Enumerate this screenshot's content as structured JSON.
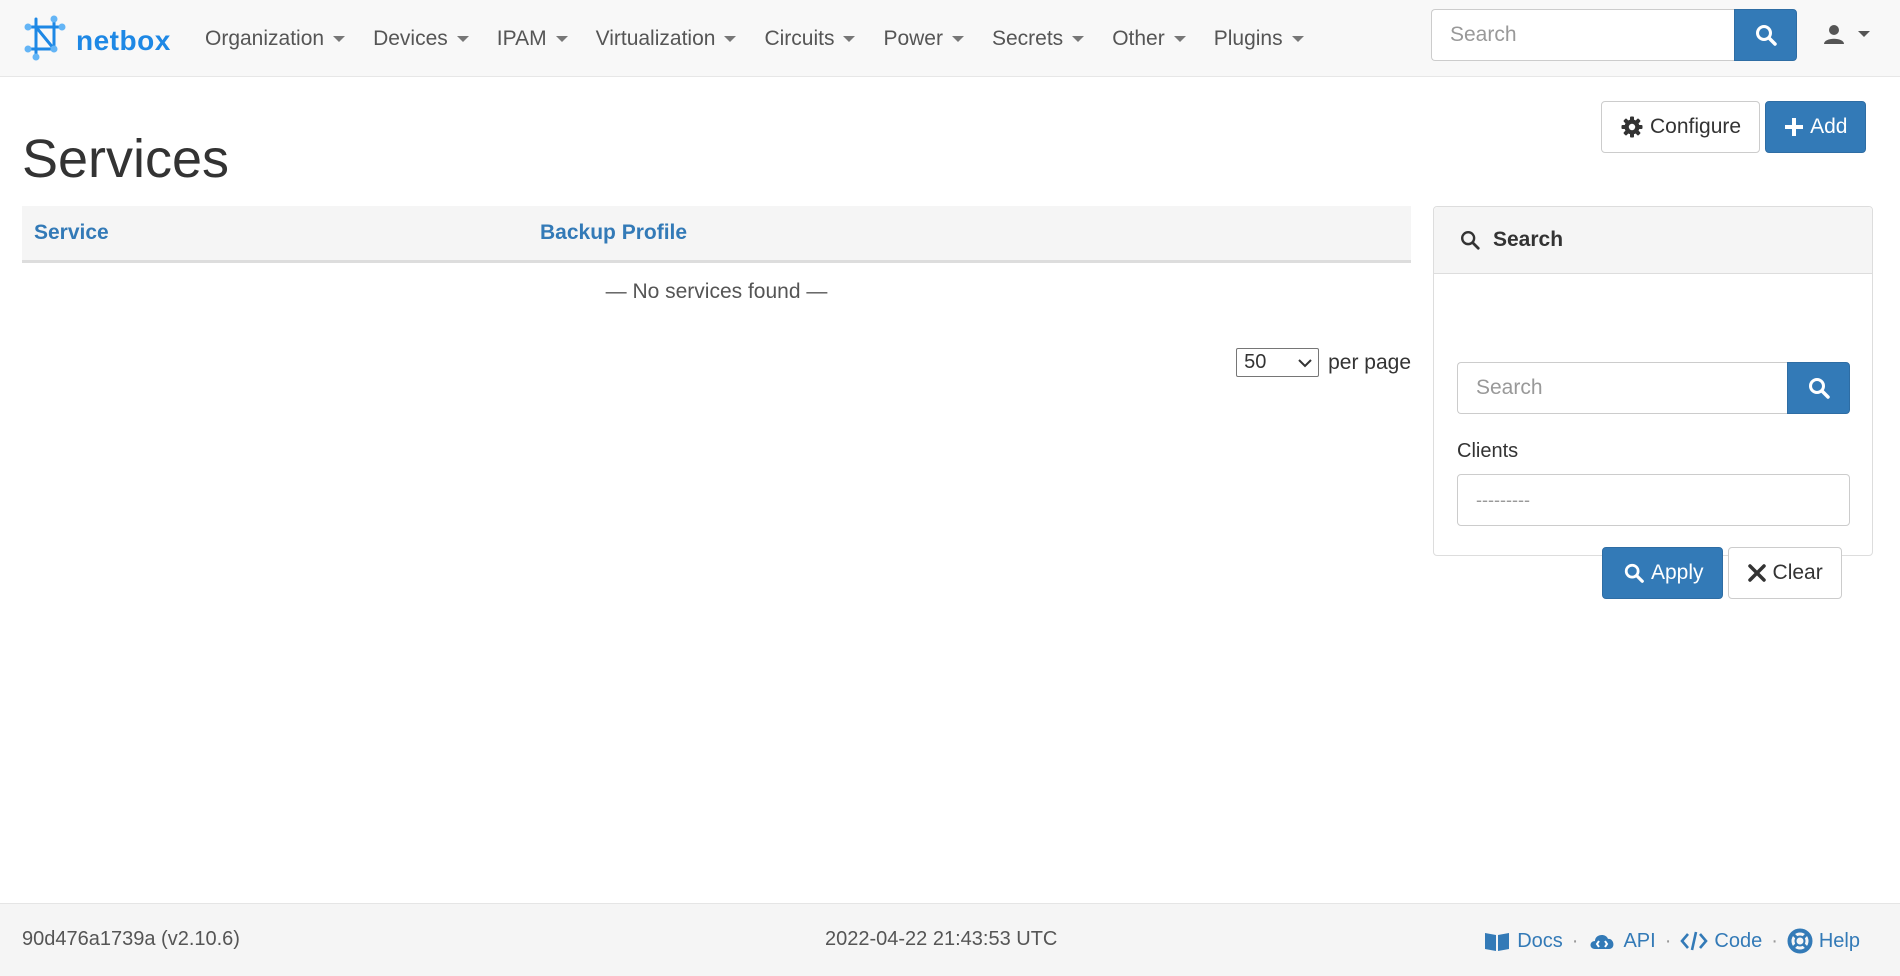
{
  "brand": {
    "name": "netbox"
  },
  "nav": {
    "items": [
      {
        "label": "Organization"
      },
      {
        "label": "Devices"
      },
      {
        "label": "IPAM"
      },
      {
        "label": "Virtualization"
      },
      {
        "label": "Circuits"
      },
      {
        "label": "Power"
      },
      {
        "label": "Secrets"
      },
      {
        "label": "Other"
      },
      {
        "label": "Plugins"
      }
    ],
    "search_placeholder": "Search"
  },
  "page": {
    "title": "Services"
  },
  "actions": {
    "configure_label": "Configure",
    "add_label": "Add"
  },
  "table": {
    "columns": [
      "Service",
      "Backup Profile"
    ],
    "empty_text": "— No services found —"
  },
  "pagination": {
    "per_page_value": "50",
    "per_page_label": "per page"
  },
  "filter_panel": {
    "title": "Search",
    "search_placeholder": "Search",
    "clients_label": "Clients",
    "clients_placeholder": "---------",
    "apply_label": "Apply",
    "clear_label": "Clear"
  },
  "footer": {
    "version": "90d476a1739a (v2.10.6)",
    "timestamp": "2022-04-22 21:43:53 UTC",
    "links": {
      "docs": "Docs",
      "api": "API",
      "code": "Code",
      "help": "Help"
    },
    "separator": "·"
  },
  "colors": {
    "primary": "#337ab7",
    "brand": "#1e88e5"
  },
  "icons": [
    "netbox-logo-icon",
    "search-icon",
    "user-icon",
    "gear-icon",
    "plus-icon",
    "chevron-down-icon",
    "close-icon",
    "book-icon",
    "cloud-icon",
    "code-icon",
    "lifebuoy-icon"
  ]
}
